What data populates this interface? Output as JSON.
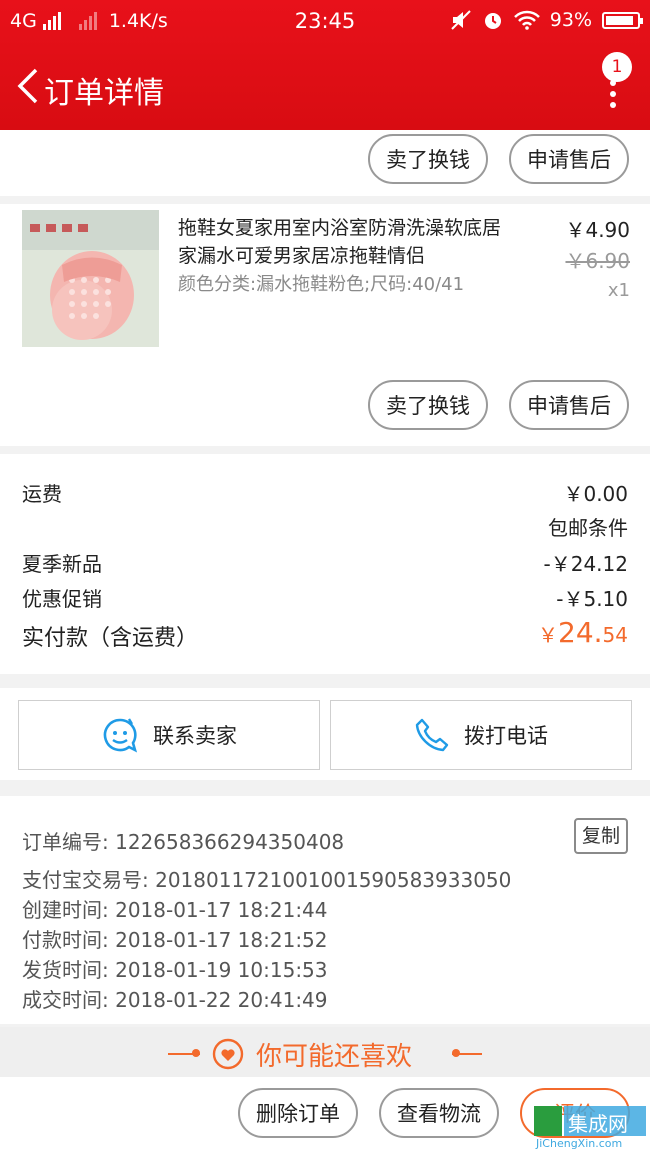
{
  "status_bar": {
    "network": "4G",
    "speed": "1.4K/s",
    "time": "23:45",
    "battery": "93%"
  },
  "header": {
    "title": "订单详情",
    "badge_count": "1"
  },
  "top_actions": {
    "sell_label": "卖了换钱",
    "aftersale_label": "申请售后"
  },
  "product": {
    "name": "拖鞋女夏家用室内浴室防滑洗澡软底居家漏水可爱男家居凉拖鞋情侣",
    "sku": "颜色分类:漏水拖鞋粉色;尺码:40/41",
    "price": "￥4.90",
    "original_price": "￥6.90",
    "quantity": "x1",
    "sell_label": "卖了换钱",
    "aftersale_label": "申请售后"
  },
  "costs": {
    "shipping_label": "运费",
    "shipping_value": "￥0.00",
    "free_shipping_link": "包邮条件",
    "summer_label": "夏季新品",
    "summer_value": "-￥24.12",
    "promo_label": "优惠促销",
    "promo_value": "-￥5.10",
    "total_label": "实付款（含运费）",
    "total_currency": "￥",
    "total_int": "24.",
    "total_dec": "54"
  },
  "contact": {
    "seller_label": "联系卖家",
    "phone_label": "拨打电话"
  },
  "order_info": {
    "order_no": "订单编号: 122658366294350408",
    "copy_label": "复制",
    "alipay_no": "支付宝交易号: 2018011721001001590583933050",
    "created": "创建时间: 2018-01-17 18:21:44",
    "paid": "付款时间: 2018-01-17 18:21:52",
    "shipped": "发货时间: 2018-01-19 10:15:53",
    "completed": "成交时间: 2018-01-22 20:41:49"
  },
  "recommend": {
    "title": "你可能还喜欢"
  },
  "bottom_bar": {
    "delete_label": "删除订单",
    "logistics_label": "查看物流",
    "review_label": "评价"
  },
  "watermark": {
    "text": "集成网",
    "url": "JiChengXin.com"
  },
  "colors": {
    "brand_red": "#e8111a",
    "accent_orange": "#f36a2c",
    "contact_blue": "#1f9be6"
  }
}
